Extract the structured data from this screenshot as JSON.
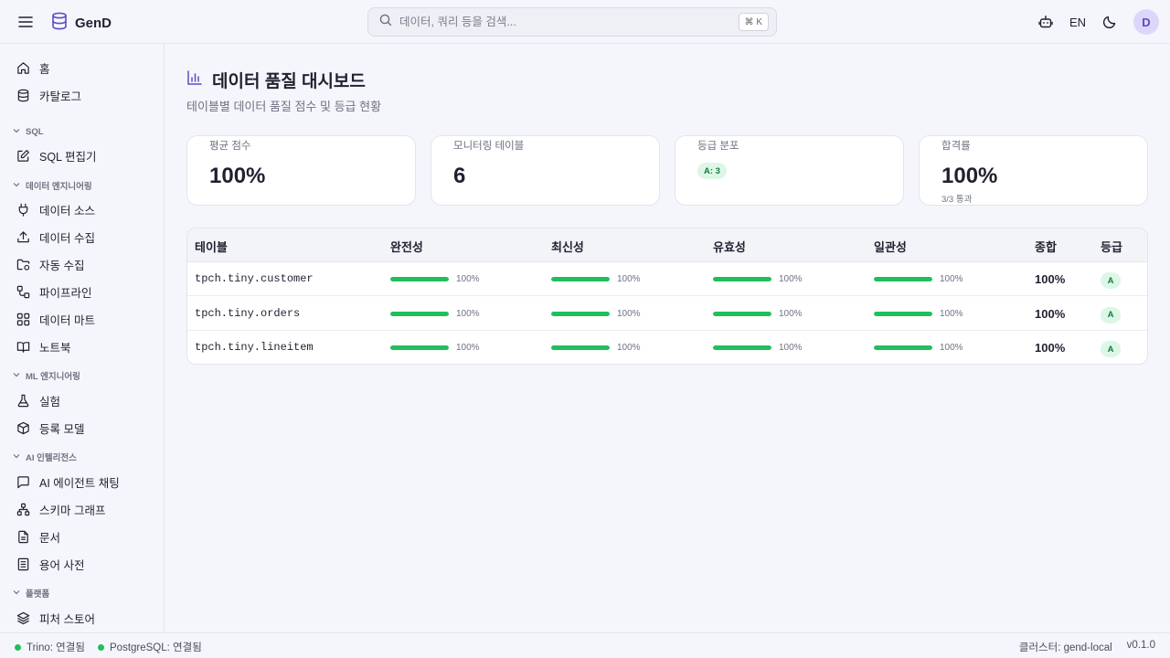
{
  "app": {
    "name": "GenD"
  },
  "header": {
    "search_placeholder": "데이터, 쿼리 등을 검색...",
    "search_shortcut": "⌘ K",
    "lang": "EN",
    "avatar_initial": "D"
  },
  "sidebar": {
    "home": "홈",
    "catalog": "카탈로그",
    "sec_sql": "SQL",
    "sql_editor": "SQL 편집기",
    "sec_data_eng": "데이터 엔지니어링",
    "data_source": "데이터 소스",
    "data_ingest": "데이터 수집",
    "auto_ingest": "자동 수집",
    "pipeline": "파이프라인",
    "data_mart": "데이터 마트",
    "notebook": "노트북",
    "sec_ml": "ML 엔지니어링",
    "experiment": "실험",
    "registered_model": "등록 모델",
    "sec_ai": "AI 인텔리전스",
    "ai_agent_chat": "AI 에이전트 채팅",
    "schema_graph": "스키마 그래프",
    "docs": "문서",
    "glossary": "용어 사전",
    "sec_platform": "플랫폼",
    "feature_store": "피처 스토어"
  },
  "page": {
    "title": "데이터 품질 대시보드",
    "subtitle": "테이블별 데이터 품질 점수 및 등급 현황"
  },
  "cards": {
    "avg_score_label": "평균 점수",
    "avg_score_value": "100%",
    "monitored_label": "모니터링 테이블",
    "monitored_value": "6",
    "grade_dist_label": "등급 분포",
    "grade_dist_value": "A: 3",
    "pass_rate_label": "합격률",
    "pass_rate_value": "100%",
    "pass_rate_sub": "3/3 통과"
  },
  "table": {
    "headers": {
      "table": "테이블",
      "completeness": "완전성",
      "freshness": "최신성",
      "validity": "유효성",
      "consistency": "일관성",
      "total": "종합",
      "grade": "등급"
    },
    "rows": [
      {
        "name": "tpch.tiny.customer",
        "completeness": "100%",
        "freshness": "100%",
        "validity": "100%",
        "consistency": "100%",
        "completeness_pct": 100,
        "freshness_pct": 100,
        "validity_pct": 100,
        "consistency_pct": 100,
        "total": "100%",
        "grade": "A"
      },
      {
        "name": "tpch.tiny.orders",
        "completeness": "100%",
        "freshness": "100%",
        "validity": "100%",
        "consistency": "100%",
        "completeness_pct": 100,
        "freshness_pct": 100,
        "validity_pct": 100,
        "consistency_pct": 100,
        "total": "100%",
        "grade": "A"
      },
      {
        "name": "tpch.tiny.lineitem",
        "completeness": "100%",
        "freshness": "100%",
        "validity": "100%",
        "consistency": "100%",
        "completeness_pct": 100,
        "freshness_pct": 100,
        "validity_pct": 100,
        "consistency_pct": 100,
        "total": "100%",
        "grade": "A"
      }
    ]
  },
  "status": {
    "trino": "Trino: 연결됨",
    "postgres": "PostgreSQL: 연결됨",
    "cluster": "클러스터: gend-local",
    "version": "v0.1.0"
  },
  "colors": {
    "accent": "#5b4bc4",
    "success": "#1fbf5c",
    "grade_bg": "#dcf7e6"
  }
}
